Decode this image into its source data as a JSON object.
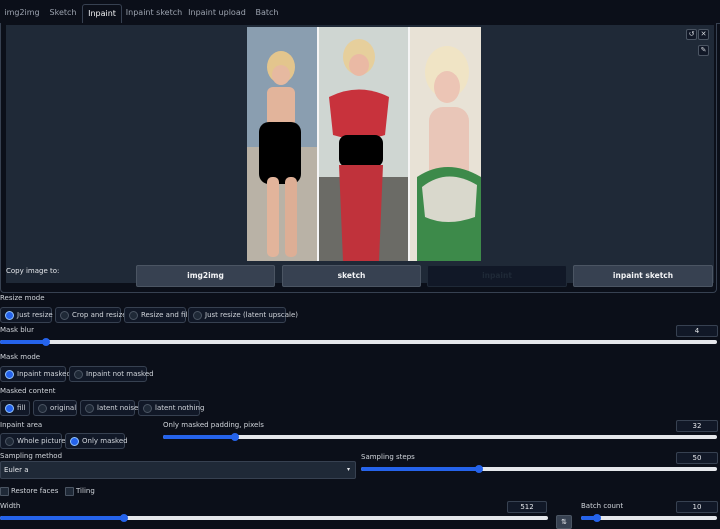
{
  "tabs": [
    {
      "label": "img2img"
    },
    {
      "label": "Sketch"
    },
    {
      "label": "Inpaint"
    },
    {
      "label": "Inpaint sketch"
    },
    {
      "label": "Inpaint upload"
    },
    {
      "label": "Batch"
    }
  ],
  "active_tab": "Inpaint",
  "canvas": {
    "undo_icon": "undo-icon",
    "close_icon": "close-icon",
    "brush_icon": "brush-icon"
  },
  "copy": {
    "label": "Copy image to:",
    "buttons": [
      "img2img",
      "sketch",
      "inpaint",
      "inpaint sketch"
    ]
  },
  "resize_mode": {
    "label": "Resize mode",
    "options": [
      "Just resize",
      "Crop and resize",
      "Resize and fill",
      "Just resize (latent upscale)"
    ],
    "selected": "Just resize"
  },
  "mask_blur": {
    "label": "Mask blur",
    "value": "4"
  },
  "mask_mode": {
    "label": "Mask mode",
    "options": [
      "Inpaint masked",
      "Inpaint not masked"
    ],
    "selected": "Inpaint masked"
  },
  "masked_content": {
    "label": "Masked content",
    "options": [
      "fill",
      "original",
      "latent noise",
      "latent nothing"
    ],
    "selected": "fill"
  },
  "inpaint_area": {
    "label": "Inpaint area",
    "options": [
      "Whole picture",
      "Only masked"
    ],
    "selected": "Only masked"
  },
  "padding": {
    "label": "Only masked padding, pixels",
    "value": "32"
  },
  "sampling_method": {
    "label": "Sampling method",
    "value": "Euler a"
  },
  "sampling_steps": {
    "label": "Sampling steps",
    "value": "50"
  },
  "restore_faces": {
    "label": "Restore faces"
  },
  "tiling": {
    "label": "Tiling"
  },
  "width": {
    "label": "Width",
    "value": "512"
  },
  "batch_count": {
    "label": "Batch count",
    "value": "10"
  },
  "swap_label": "⇅"
}
